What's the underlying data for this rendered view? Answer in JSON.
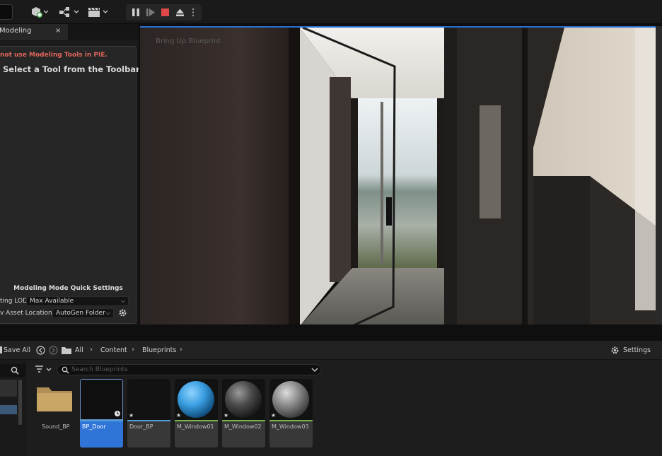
{
  "panel": {
    "tab_label": "Modeling",
    "tab_close": "×",
    "warning": "not use Modeling Tools in PIE.",
    "select_tool": "Select a Tool from the Toolbar",
    "quick_settings_title": "Modeling Mode Quick Settings",
    "lod_label": "ting LOD",
    "lod_value": "Max Available",
    "asset_location_label": "v Asset Location",
    "asset_location_value": "AutoGen Folder"
  },
  "viewport": {
    "overlay_text": "Bring Up Blueprint"
  },
  "content_browser": {
    "save_all": "Save All",
    "breadcrumb": [
      "All",
      "Content",
      "Blueprints"
    ],
    "settings_label": "Settings",
    "search_placeholder": "Search Blueprints",
    "assets": [
      {
        "name": "Sound_BP",
        "kind": "folder",
        "selected": false
      },
      {
        "name": "BP_Door",
        "kind": "blueprint",
        "selected": true
      },
      {
        "name": "Door_BP",
        "kind": "blueprint",
        "selected": false
      },
      {
        "name": "M_Window01",
        "kind": "material-blue",
        "selected": false
      },
      {
        "name": "M_Window02",
        "kind": "material-dark",
        "selected": false
      },
      {
        "name": "M_Window03",
        "kind": "material-grey",
        "selected": false
      }
    ]
  },
  "colors": {
    "accent": "#2f74d6",
    "warning": "#e0665c",
    "stop": "#e04848",
    "material_bar": "#78b450",
    "blueprint_bar": "#4ea0d8"
  }
}
